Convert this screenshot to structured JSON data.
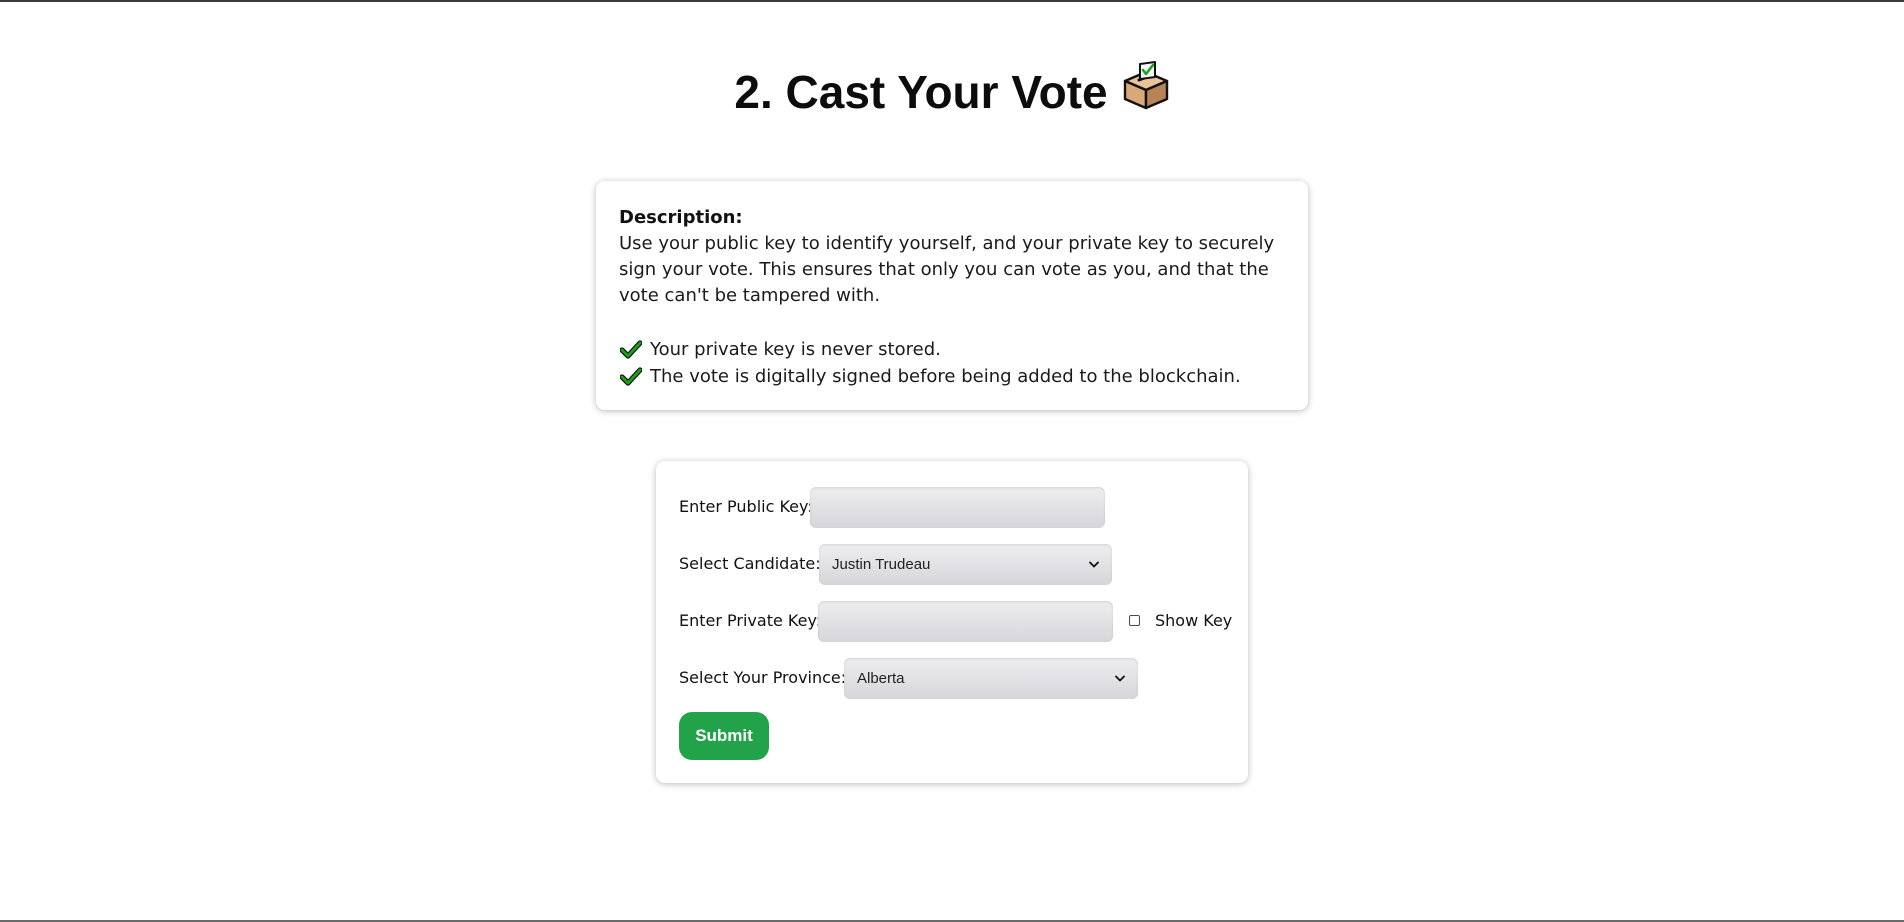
{
  "page": {
    "title": "2. Cast Your Vote",
    "title_icon": "ballot-box-icon"
  },
  "description": {
    "heading": "Description:",
    "body": "Use your public key to identify yourself, and your private key to securely sign your vote. This ensures that only you can vote as you, and that the vote can't be tampered with.",
    "points": [
      "Your private key is never stored.",
      "The vote is digitally signed before being added to the blockchain."
    ],
    "point_icon": "check-mark-icon",
    "check_color": "#1aa31a"
  },
  "form": {
    "public_key": {
      "label": "Enter Public Key:",
      "value": "",
      "placeholder": ""
    },
    "candidate": {
      "label": "Select Candidate:",
      "selected": "Justin Trudeau"
    },
    "private_key": {
      "label": "Enter Private Key:",
      "value": "",
      "placeholder": "",
      "show_key_label": "Show Key",
      "show_key_checked": false
    },
    "province": {
      "label": "Select Your Province:",
      "selected": "Alberta"
    },
    "submit_label": "Submit",
    "submit_color": "#22a249"
  }
}
